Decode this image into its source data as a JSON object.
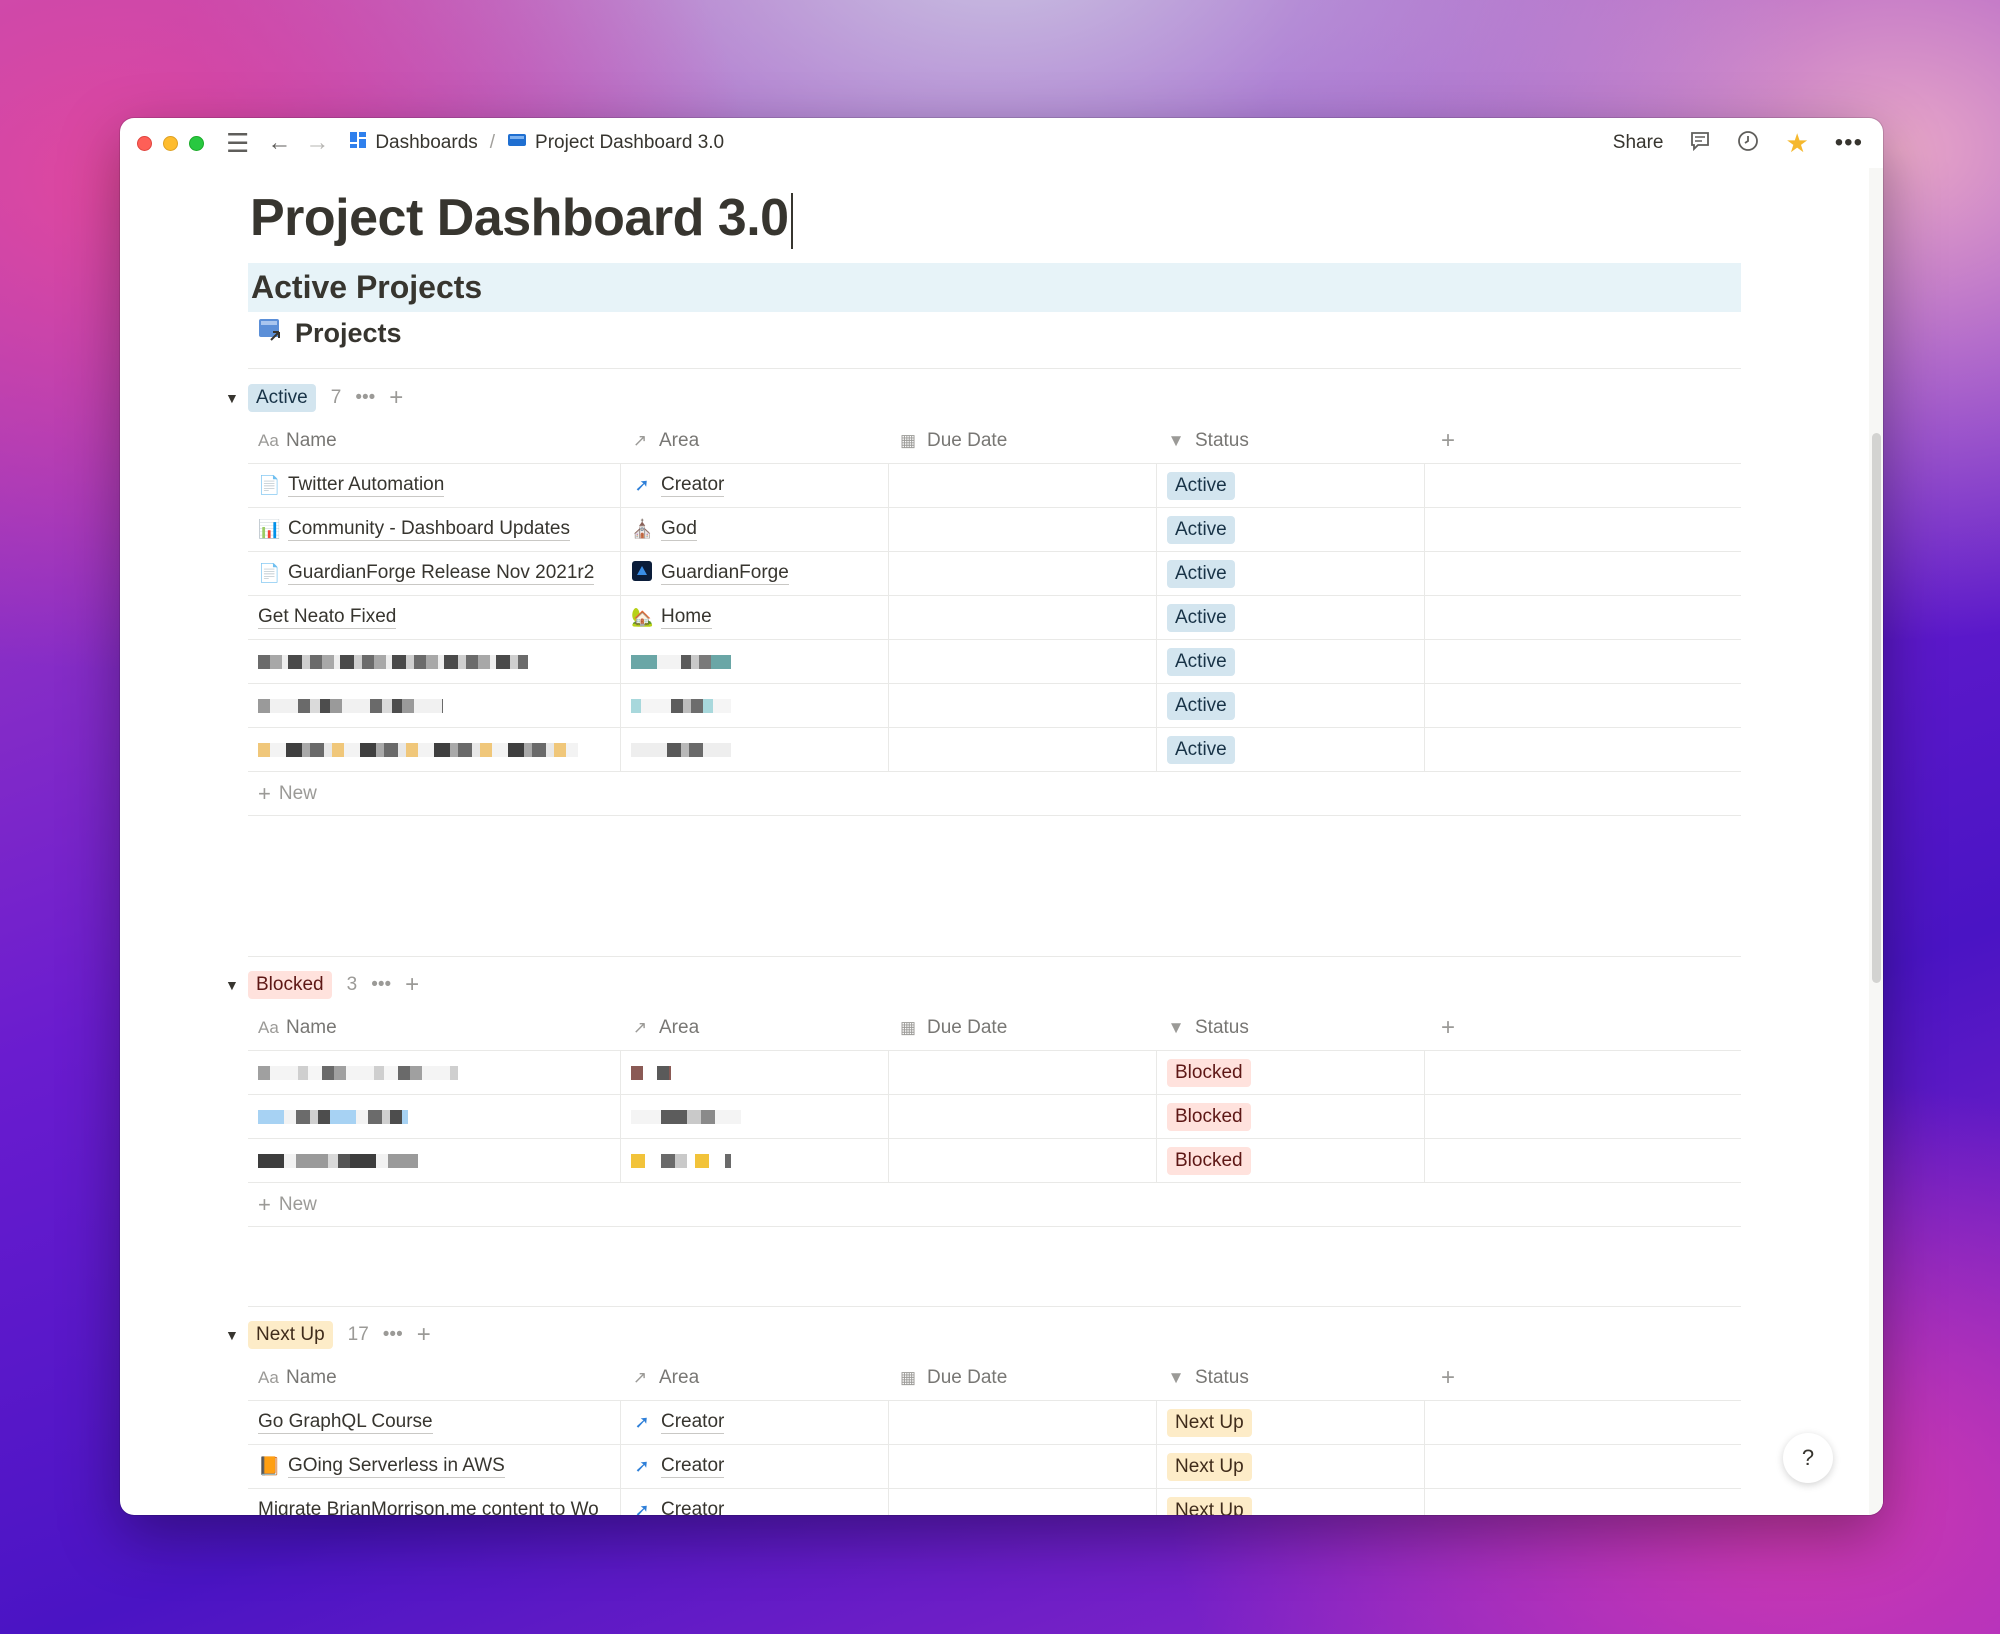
{
  "window": {
    "breadcrumb": [
      "Dashboards",
      "Project Dashboard 3.0"
    ],
    "share_label": "Share"
  },
  "page": {
    "title": "Project Dashboard 3.0",
    "section_heading": "Active Projects",
    "database_title": "Projects"
  },
  "columns": {
    "name": "Name",
    "area": "Area",
    "due": "Due Date",
    "status": "Status",
    "add": "+"
  },
  "groups": {
    "active": {
      "label": "Active",
      "count": "7",
      "rows": [
        {
          "name": "Twitter Automation",
          "name_icon": "page-icon",
          "area": "Creator",
          "area_icon": "rocket-icon",
          "status": "Active"
        },
        {
          "name": "Community - Dashboard Updates",
          "name_icon": "chart-icon",
          "area": "God",
          "area_icon": "church-icon",
          "status": "Active"
        },
        {
          "name": "GuardianForge Release Nov 2021r2",
          "name_icon": "page-icon",
          "area": "GuardianForge",
          "area_icon": "guardianforge-icon",
          "status": "Active"
        },
        {
          "name": "Get Neato Fixed",
          "name_icon": "",
          "area": "Home",
          "area_icon": "house-icon",
          "status": "Active"
        },
        {
          "name": "",
          "area": "",
          "status": "Active"
        },
        {
          "name": "",
          "area": "",
          "status": "Active"
        },
        {
          "name": "",
          "area": "",
          "status": "Active"
        }
      ],
      "new_label": "New"
    },
    "blocked": {
      "label": "Blocked",
      "count": "3",
      "rows": [
        {
          "name": "",
          "area": "",
          "status": "Blocked"
        },
        {
          "name": "",
          "area": "",
          "status": "Blocked"
        },
        {
          "name": "",
          "area": "",
          "status": "Blocked"
        }
      ],
      "new_label": "New"
    },
    "nextup": {
      "label": "Next Up",
      "count": "17",
      "rows": [
        {
          "name": "Go GraphQL Course",
          "area": "Creator",
          "area_icon": "rocket-icon",
          "status": "Next Up"
        },
        {
          "name": "GOing Serverless in AWS",
          "name_icon": "book-icon",
          "area": "Creator",
          "area_icon": "rocket-icon",
          "status": "Next Up"
        },
        {
          "name": "Migrate BrianMorrison.me content to Wo",
          "area": "Creator",
          "area_icon": "rocket-icon",
          "status": "Next Up"
        }
      ]
    }
  },
  "help_label": "?"
}
